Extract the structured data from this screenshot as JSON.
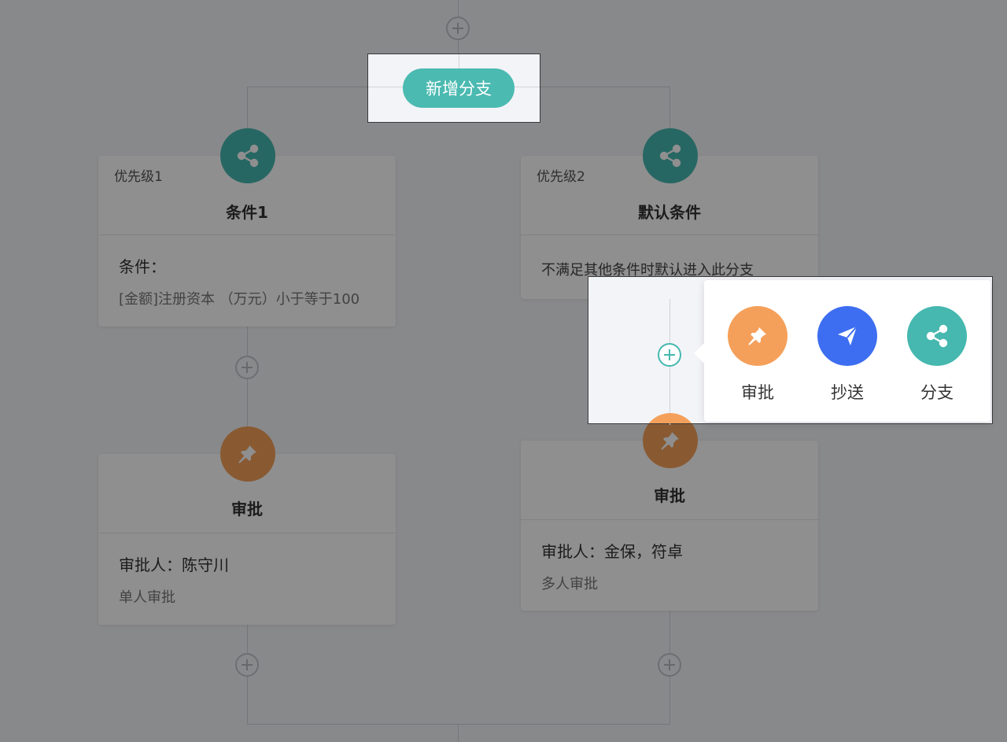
{
  "branch_button": {
    "label": "新增分支"
  },
  "branches": [
    {
      "priority": "优先级1",
      "title": "条件1",
      "condition_label": "条件：",
      "condition_text": "[金额]注册资本 （万元）小于等于100",
      "approval": {
        "title": "审批",
        "approvers": "审批人：陈守川",
        "mode": "单人审批"
      }
    },
    {
      "priority": "优先级2",
      "title": "默认条件",
      "condition_text": "不满足其他条件时默认进入此分支",
      "approval": {
        "title": "审批",
        "approvers": "审批人：金保，符卓",
        "mode": "多人审批"
      }
    }
  ],
  "popover": {
    "options": [
      {
        "label": "审批",
        "icon": "pin-icon",
        "color": "#f5a05a"
      },
      {
        "label": "抄送",
        "icon": "paper-plane-icon",
        "color": "#3d6ef1"
      },
      {
        "label": "分支",
        "icon": "branch-icon",
        "color": "#46b8b0"
      }
    ]
  },
  "colors": {
    "teal": "#46b8b0",
    "orange": "#f5a05a",
    "blue": "#3d6ef1",
    "overlay": "rgba(0,0,0,0.44)"
  }
}
